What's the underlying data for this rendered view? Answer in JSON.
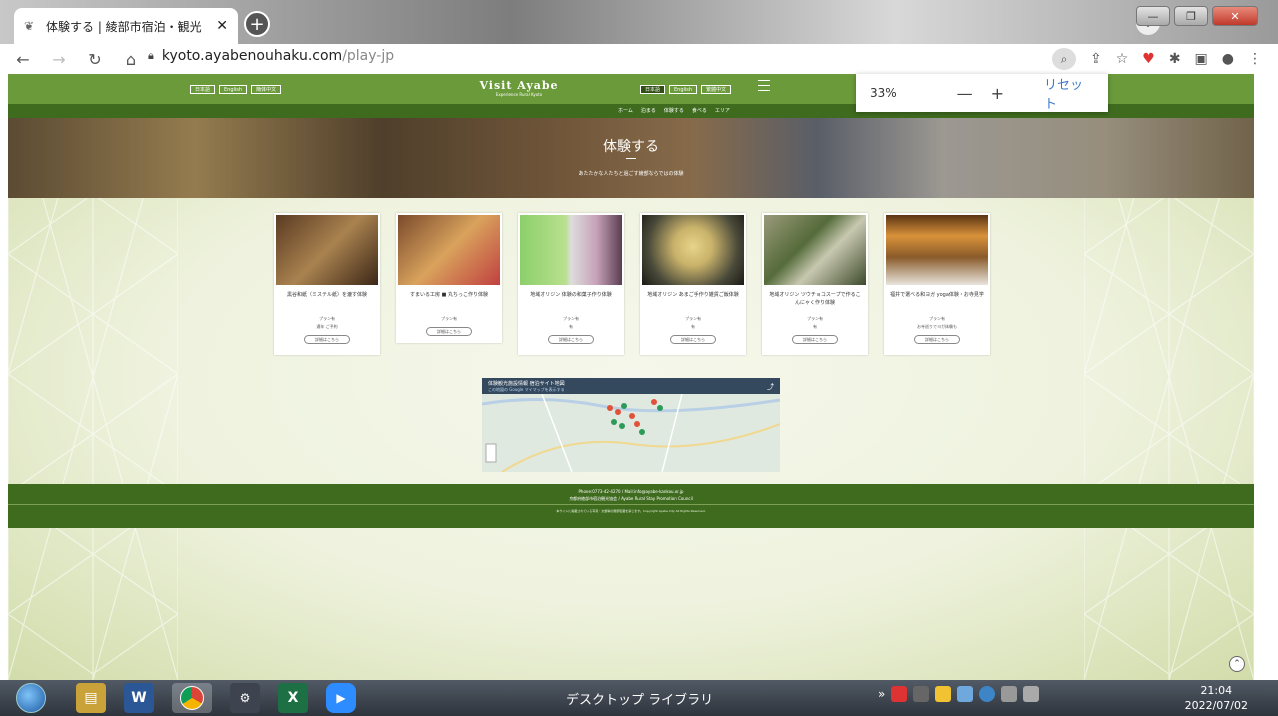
{
  "browser": {
    "tab_title": "体験する | 綾部市宿泊・観光",
    "tab_favicon": "leaf-icon",
    "new_tab": "+",
    "url_host": "kyoto.ayabenouhaku.com",
    "url_path": "/play-jp"
  },
  "zoom_popup": {
    "level": "33%",
    "minus": "—",
    "plus": "+",
    "reset": "リセット"
  },
  "site": {
    "logo_main": "Visit Ayabe",
    "logo_sub": "Experience Rural Kyoto",
    "lang_left": [
      "日本語",
      "English",
      "簡体中文"
    ],
    "lang_right": [
      "日本語",
      "English",
      "繁體中文"
    ],
    "subnav": [
      "ホーム",
      "泊まる",
      "体験する",
      "食べる",
      "エリア"
    ],
    "hero_title": "体験する",
    "hero_sub": "あたたかな人たちと過ごす綾部ならではの体験"
  },
  "cards": [
    {
      "title": "黒谷和紙（ミステル紙）を漉す体験",
      "meta1": "プラン有",
      "meta2": "通年 ご予約",
      "button": "詳細はこちら"
    },
    {
      "title": "すまいる工房 ■ 丸ちっこ作り体験",
      "meta1": "プラン有",
      "meta2": "",
      "button": "詳細はこちら"
    },
    {
      "title": "地域オリジン 体験の和菓子作り体験",
      "meta1": "プラン有",
      "meta2": "有",
      "button": "詳細はこちら"
    },
    {
      "title": "地域オリジン あまご手作り雑貨ご飯体験",
      "meta1": "プラン有",
      "meta2": "有",
      "button": "詳細はこちら"
    },
    {
      "title": "地域オリジン ツウチョコスープで作るこんにゃく作り体験",
      "meta1": "プラン有",
      "meta2": "有",
      "button": "詳細はこちら"
    },
    {
      "title": "福井で選べる和ヨガ yoga体験・お寺見学",
      "meta1": "プラン有",
      "meta2": "お寺巡りでヨガ体験も",
      "button": "詳細はこちら"
    }
  ],
  "map": {
    "title": "体験観光施設情報 宿泊サイト地図",
    "subtitle": "この地図の Google マイマップを表示する"
  },
  "footer": {
    "line1": "Phone:0773-42-4270 / Mail:info@ayabe-kankou.or.jp",
    "line2": "京都府綾部市宿泊観光協会 / Ayabe Rural Stay Promotion Council",
    "line3": "本サイトに掲載されている写真・文章等の無断転載を禁じます。Copyright Ayabe City All Rights Reserved."
  },
  "taskbar": {
    "label": "デスクトップ ライブラリ",
    "time": "21:04",
    "date": "2022/07/02",
    "apps": [
      "windows-explorer-icon",
      "word-icon",
      "chrome-icon",
      "system-icon",
      "excel-icon",
      "zoom-icon"
    ]
  },
  "colors": {
    "header_green": "#6a9a3a",
    "dark_green": "#3f6b1f",
    "background": "#eef2dd"
  }
}
